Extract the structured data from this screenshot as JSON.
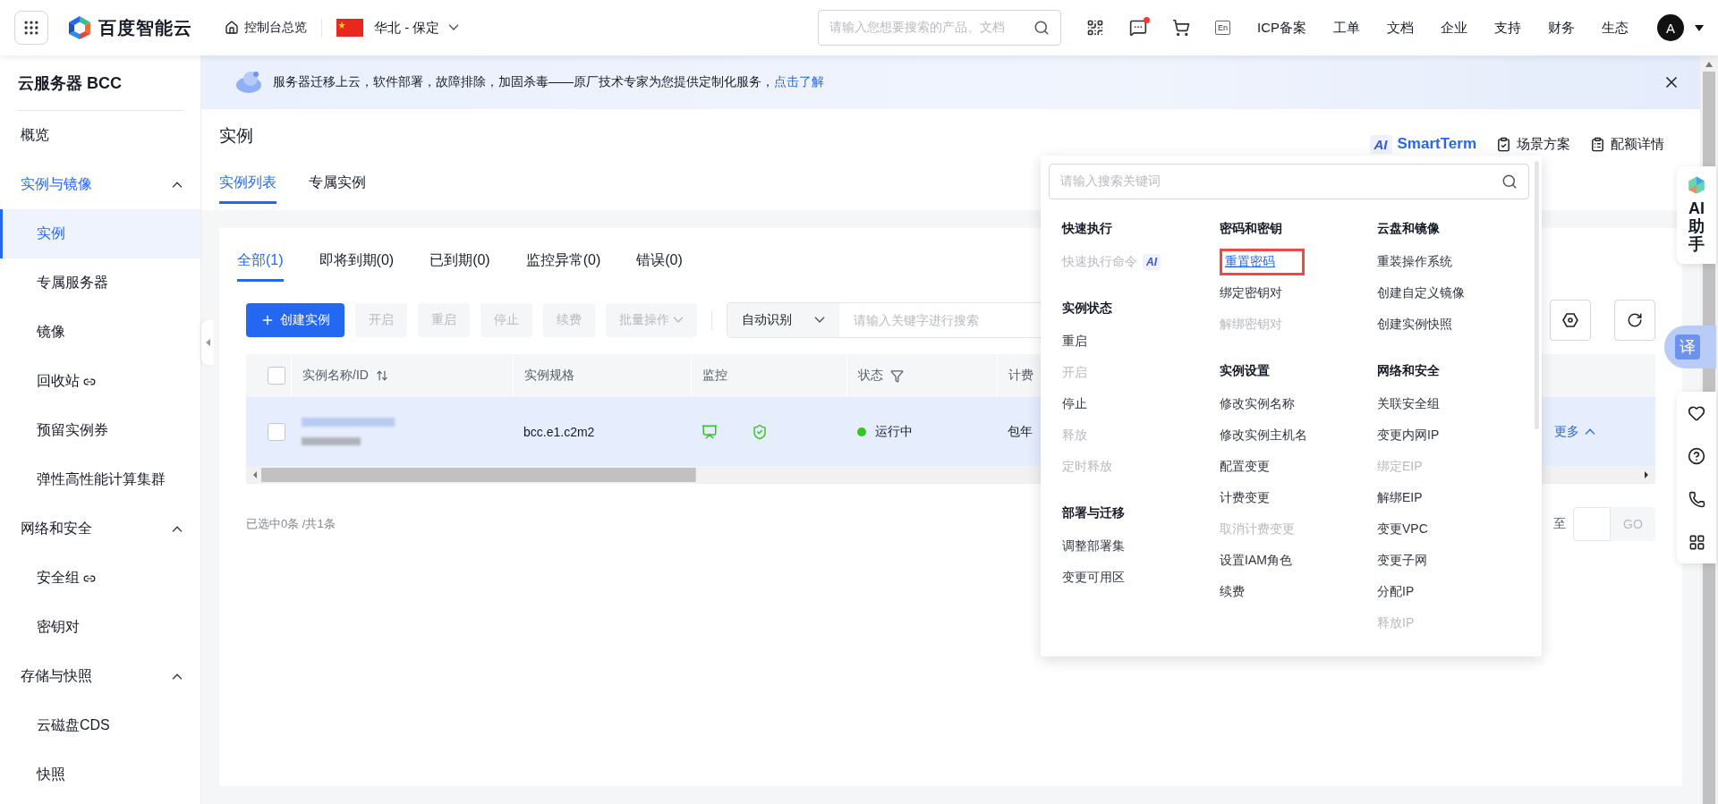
{
  "top_bar": {
    "logo_text": "百度智能云",
    "console_link": "控制台总览",
    "region": "华北 - 保定",
    "search": {
      "placeholder": "请输入您想要搜索的产品、文档"
    },
    "messages_unread": true,
    "lang_badge": "En",
    "nav_links": [
      "ICP备案",
      "工单",
      "文档",
      "企业",
      "支持",
      "财务",
      "生态"
    ],
    "avatar": "A"
  },
  "sidebar": {
    "title": "云服务器 BCC",
    "items": [
      {
        "label": "概览",
        "kind": "link"
      },
      {
        "label": "实例与镜像",
        "kind": "group",
        "expanded": true,
        "children": [
          {
            "label": "实例",
            "selected": true,
            "external": false
          },
          {
            "label": "专属服务器",
            "selected": false,
            "external": false
          },
          {
            "label": "镜像",
            "selected": false,
            "external": false
          },
          {
            "label": "回收站",
            "selected": false,
            "external": true
          },
          {
            "label": "预留实例券",
            "selected": false,
            "external": false
          },
          {
            "label": "弹性高性能计算集群",
            "selected": false,
            "external": false
          }
        ]
      },
      {
        "label": "网络和安全",
        "kind": "group",
        "expanded": true,
        "children": [
          {
            "label": "安全组",
            "selected": false,
            "external": true
          },
          {
            "label": "密钥对",
            "selected": false,
            "external": false
          }
        ]
      },
      {
        "label": "存储与快照",
        "kind": "group",
        "expanded": true,
        "children": [
          {
            "label": "云磁盘CDS",
            "selected": false,
            "external": false
          },
          {
            "label": "快照",
            "selected": false,
            "external": false
          }
        ]
      }
    ]
  },
  "banner": {
    "text": "服务器迁移上云，软件部署，故障排除，加固杀毒——原厂技术专家为您提供定制化服务，",
    "link": "点击了解"
  },
  "page": {
    "title": "实例",
    "actions": [
      {
        "kind": "ai",
        "badge": "AI",
        "label": "SmartTerm"
      },
      {
        "kind": "checklist",
        "label": "场景方案"
      },
      {
        "kind": "list",
        "label": "配额详情"
      }
    ],
    "tabs": [
      {
        "label": "实例列表",
        "selected": true
      },
      {
        "label": "专属实例",
        "selected": false
      }
    ]
  },
  "filters": [
    {
      "label": "全部(1)",
      "selected": true
    },
    {
      "label": "即将到期(0)",
      "selected": false
    },
    {
      "label": "已到期(0)",
      "selected": false
    },
    {
      "label": "监控异常(0)",
      "selected": false
    },
    {
      "label": "错误(0)",
      "selected": false
    }
  ],
  "toolbar": {
    "create": "创建实例",
    "buttons": [
      {
        "label": "开启",
        "kind": "plain",
        "disabled": true
      },
      {
        "label": "重启",
        "kind": "plain",
        "disabled": true
      },
      {
        "label": "停止",
        "kind": "plain",
        "disabled": true
      },
      {
        "label": "续费",
        "kind": "plain",
        "disabled": true
      },
      {
        "label": "批量操作",
        "kind": "menu",
        "disabled": true
      }
    ],
    "search_mode": "自动识别",
    "search_placeholder": "请输入关键字进行搜索"
  },
  "table": {
    "columns": [
      {
        "label": "实例名称/ID",
        "kind": "sort"
      },
      {
        "label": "实例规格",
        "kind": "plain"
      },
      {
        "label": "监控",
        "kind": "plain"
      },
      {
        "label": "状态",
        "kind": "filter"
      },
      {
        "label": "计费",
        "kind": "plain"
      }
    ],
    "header_checked": false,
    "rows": [
      {
        "checked": false,
        "highlighted": true,
        "spec": "bcc.e1.c2m2",
        "status": "运行中",
        "color": "#34c724",
        "billing": "包年",
        "action": "更多"
      }
    ]
  },
  "footer": {
    "summary": "已选中0条 /共1条",
    "jump_label": "至",
    "go": "GO"
  },
  "menu": {
    "search_placeholder": "请输入搜索关键词",
    "columns": [
      [
        {
          "title": "快速执行",
          "items": [
            {
              "label": "快速执行命令",
              "kind": "ai",
              "badge": "AI",
              "disabled": true,
              "highlighted": false
            }
          ]
        },
        {
          "title": "实例状态",
          "items": [
            {
              "label": "重启",
              "kind": "plain",
              "disabled": false,
              "highlighted": false
            },
            {
              "label": "开启",
              "kind": "plain",
              "disabled": true,
              "highlighted": false
            },
            {
              "label": "停止",
              "kind": "plain",
              "disabled": false,
              "highlighted": false
            },
            {
              "label": "释放",
              "kind": "plain",
              "disabled": true,
              "highlighted": false
            },
            {
              "label": "定时释放",
              "kind": "plain",
              "disabled": true,
              "highlighted": false
            }
          ]
        },
        {
          "title": "部署与迁移",
          "items": [
            {
              "label": "调整部署集",
              "kind": "plain",
              "disabled": false,
              "highlighted": false
            },
            {
              "label": "变更可用区",
              "kind": "plain",
              "disabled": false,
              "highlighted": false
            }
          ]
        }
      ],
      [
        {
          "title": "密码和密钥",
          "items": [
            {
              "label": "重置密码",
              "kind": "plain",
              "disabled": false,
              "highlighted": true
            },
            {
              "label": "绑定密钥对",
              "kind": "plain",
              "disabled": false,
              "highlighted": false
            },
            {
              "label": "解绑密钥对",
              "kind": "plain",
              "disabled": true,
              "highlighted": false
            }
          ]
        },
        {
          "title": "实例设置",
          "items": [
            {
              "label": "修改实例名称",
              "kind": "plain",
              "disabled": false,
              "highlighted": false
            },
            {
              "label": "修改实例主机名",
              "kind": "plain",
              "disabled": false,
              "highlighted": false
            },
            {
              "label": "配置变更",
              "kind": "plain",
              "disabled": false,
              "highlighted": false
            },
            {
              "label": "计费变更",
              "kind": "plain",
              "disabled": false,
              "highlighted": false
            },
            {
              "label": "取消计费变更",
              "kind": "plain",
              "disabled": true,
              "highlighted": false
            },
            {
              "label": "设置IAM角色",
              "kind": "plain",
              "disabled": false,
              "highlighted": false
            },
            {
              "label": "续费",
              "kind": "plain",
              "disabled": false,
              "highlighted": false
            }
          ]
        }
      ],
      [
        {
          "title": "云盘和镜像",
          "items": [
            {
              "label": "重装操作系统",
              "kind": "plain",
              "disabled": false,
              "highlighted": false
            },
            {
              "label": "创建自定义镜像",
              "kind": "plain",
              "disabled": false,
              "highlighted": false
            },
            {
              "label": "创建实例快照",
              "kind": "plain",
              "disabled": false,
              "highlighted": false
            }
          ]
        },
        {
          "title": "网络和安全",
          "items": [
            {
              "label": "关联安全组",
              "kind": "plain",
              "disabled": false,
              "highlighted": false
            },
            {
              "label": "变更内网IP",
              "kind": "plain",
              "disabled": false,
              "highlighted": false
            },
            {
              "label": "绑定EIP",
              "kind": "plain",
              "disabled": true,
              "highlighted": false
            },
            {
              "label": "解绑EIP",
              "kind": "plain",
              "disabled": false,
              "highlighted": false
            },
            {
              "label": "变更VPC",
              "kind": "plain",
              "disabled": false,
              "highlighted": false
            },
            {
              "label": "变更子网",
              "kind": "plain",
              "disabled": false,
              "highlighted": false
            },
            {
              "label": "分配IP",
              "kind": "plain",
              "disabled": false,
              "highlighted": false
            },
            {
              "label": "释放IP",
              "kind": "plain",
              "disabled": true,
              "highlighted": false
            }
          ]
        }
      ]
    ]
  },
  "float": {
    "assistant": "AI助手",
    "translate": "译"
  }
}
